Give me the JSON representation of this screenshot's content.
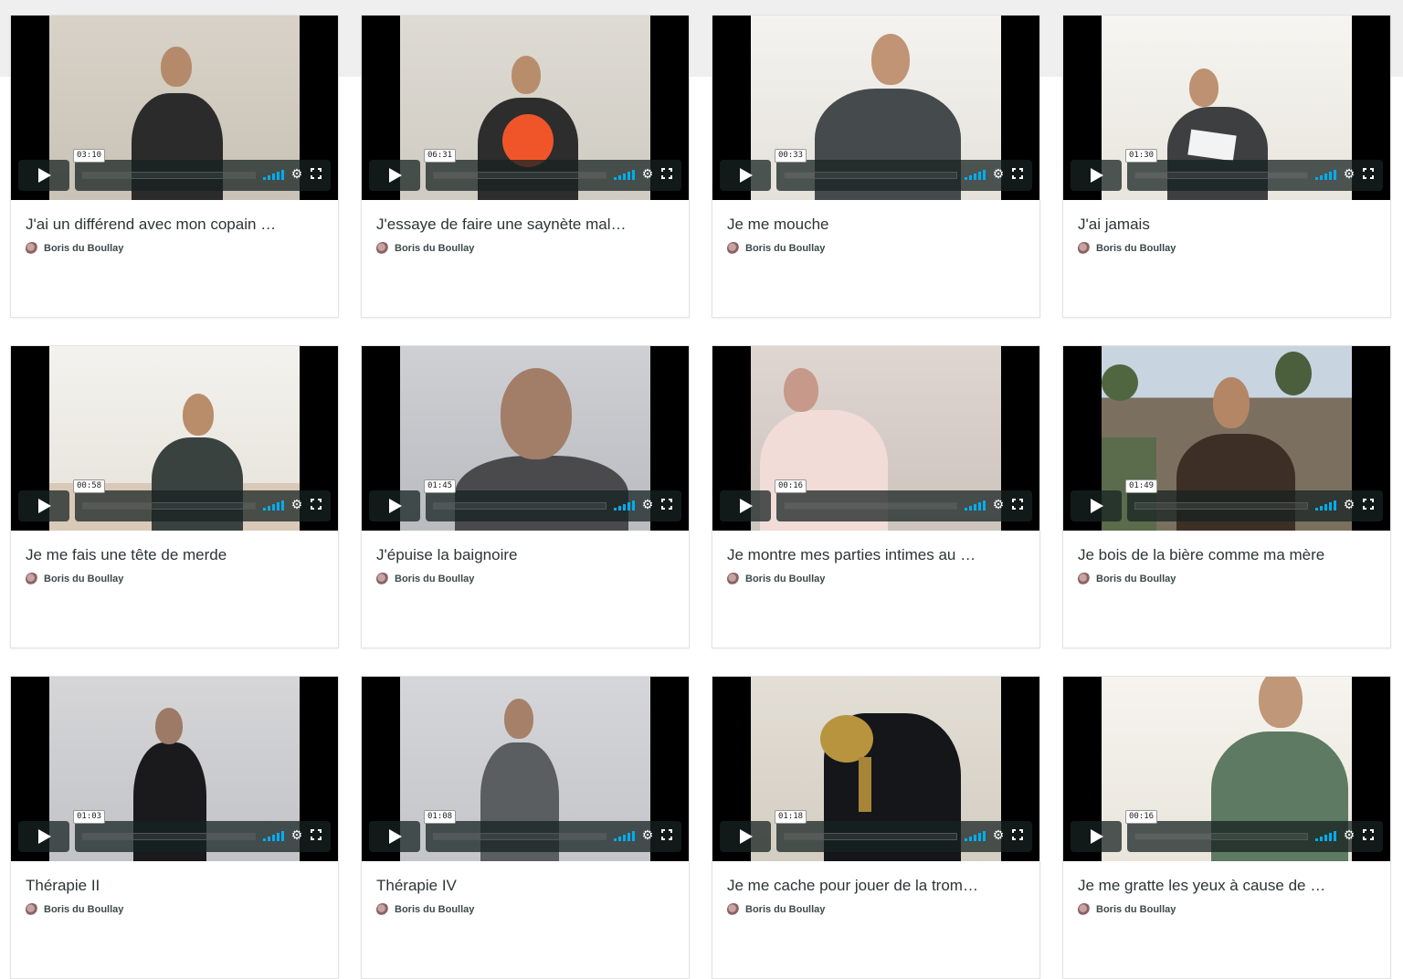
{
  "videos": [
    {
      "title": "J'ai un différend avec mon copain …",
      "author": "Boris du Boullay",
      "duration": "03:10"
    },
    {
      "title": "J'essaye de faire une saynète mal…",
      "author": "Boris du Boullay",
      "duration": "06:31"
    },
    {
      "title": "Je me mouche",
      "author": "Boris du Boullay",
      "duration": "00:33"
    },
    {
      "title": "J'ai jamais",
      "author": "Boris du Boullay",
      "duration": "01:30"
    },
    {
      "title": "Je me fais une tête de merde",
      "author": "Boris du Boullay",
      "duration": "00:58"
    },
    {
      "title": "J'épuise la baignoire",
      "author": "Boris du Boullay",
      "duration": "01:45"
    },
    {
      "title": "Je montre mes parties intimes au …",
      "author": "Boris du Boullay",
      "duration": "00:16"
    },
    {
      "title": "Je bois de la bière comme ma mère",
      "author": "Boris du Boullay",
      "duration": "01:49"
    },
    {
      "title": "Thérapie II",
      "author": "Boris du Boullay",
      "duration": "01:03"
    },
    {
      "title": "Thérapie IV",
      "author": "Boris du Boullay",
      "duration": "01:08"
    },
    {
      "title": "Je me cache pour jouer de la trom…",
      "author": "Boris du Boullay",
      "duration": "01:18"
    },
    {
      "title": "Je me gratte les yeux à cause de …",
      "author": "Boris du Boullay",
      "duration": "00:16"
    }
  ],
  "icons": {
    "play": "play-icon",
    "volume": "volume-icon",
    "settings": "gear-icon",
    "fullscreen": "fullscreen-icon",
    "avatar": "author-avatar-icon"
  },
  "colors": {
    "accent": "#00adef",
    "control_bg": "#172322",
    "title_text": "#2d3436",
    "top_band": "#efefef"
  }
}
